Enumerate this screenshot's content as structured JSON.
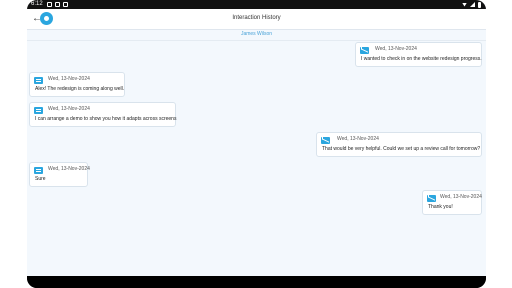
{
  "status": {
    "time": "6:12"
  },
  "appbar": {
    "title": "Interaction History",
    "back_icon": "back-arrow-icon",
    "logo_icon": "app-logo-icon"
  },
  "contact": {
    "name": "James Wilson"
  },
  "messages": [
    {
      "direction": "sent",
      "date": "Wed, 13-Nov-2024",
      "text": "I wanted to check in on the website redesign progress."
    },
    {
      "direction": "received",
      "date": "Wed, 13-Nov-2024",
      "text": "Alex! The redesign is coming along well."
    },
    {
      "direction": "received",
      "date": "Wed, 13-Nov-2024",
      "text": "I can arrange a demo to show you how it adapts across screens"
    },
    {
      "direction": "sent",
      "date": "Wed, 13-Nov-2024",
      "text": "That would be very helpful. Could we set up a review call for tomorrow?"
    },
    {
      "direction": "received",
      "date": "Wed, 13-Nov-2024",
      "text": "Sure"
    },
    {
      "direction": "sent",
      "date": "Wed, 13-Nov-2024",
      "text": "Thank you!"
    }
  ],
  "colors": {
    "accent": "#2aa6df",
    "background": "#f3f8fd"
  }
}
